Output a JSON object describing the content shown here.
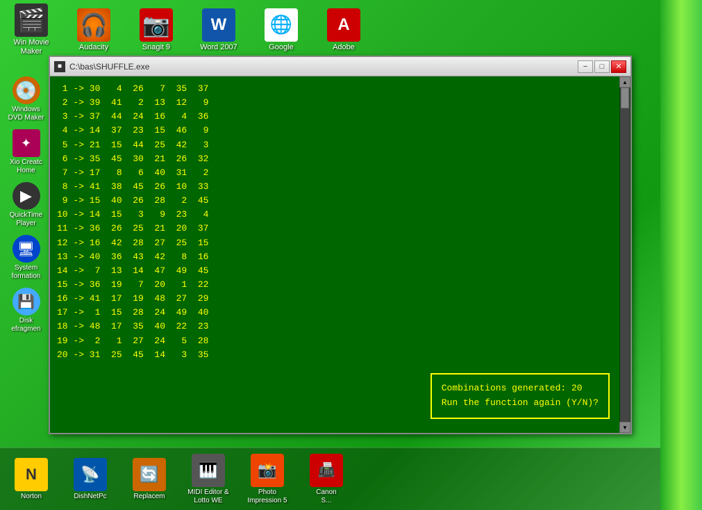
{
  "desktop": {
    "background": "#22aa22"
  },
  "top_icons": [
    {
      "id": "win-movie-maker",
      "label": "Win Movie\nMaker",
      "symbol": "🎬"
    },
    {
      "id": "audacity",
      "label": "Audacity",
      "symbol": "🎵"
    },
    {
      "id": "snagit-9",
      "label": "Snagit 9",
      "symbol": "📷"
    },
    {
      "id": "word-2007",
      "label": "Word 2007",
      "symbol": "W"
    },
    {
      "id": "google",
      "label": "Google",
      "symbol": "G"
    },
    {
      "id": "adobe",
      "label": "Adobe",
      "symbol": "A"
    }
  ],
  "left_icons": [
    {
      "id": "windows-dvd-maker",
      "label": "Windows\nDVD Maker",
      "symbol": "💿"
    },
    {
      "id": "xio-create-home",
      "label": "Xio Creat\nHome",
      "symbol": "✦"
    },
    {
      "id": "quicktime-player",
      "label": "QuickTime\nPlayer",
      "symbol": "▶"
    },
    {
      "id": "system-information",
      "label": "System\nformation",
      "symbol": "🖥"
    },
    {
      "id": "disk-defragment",
      "label": "Disk\nefragmen",
      "symbol": "💾"
    }
  ],
  "taskbar_icons": [
    {
      "id": "norton",
      "label": "Norton",
      "symbol": "N"
    },
    {
      "id": "dishnetpc",
      "label": "DishNetPc",
      "symbol": "📡"
    },
    {
      "id": "replacem",
      "label": "Replacem",
      "symbol": "🔄"
    },
    {
      "id": "midi-editor-lotto",
      "label": "MIDI Editor &\nLotto WE",
      "symbol": "🎹"
    },
    {
      "id": "photo-impression-5",
      "label": "Photo\nImpression 5",
      "symbol": "📸"
    },
    {
      "id": "canon",
      "label": "Canon\nS...",
      "symbol": "📠"
    }
  ],
  "window": {
    "title": "C:\\bas\\SHUFFLE.exe",
    "min_label": "−",
    "max_label": "□",
    "close_label": "✕"
  },
  "console": {
    "lines": [
      " 1 -> 30   4  26   7  35  37",
      " 2 -> 39  41   2  13  12   9",
      " 3 -> 37  44  24  16   4  36",
      " 4 -> 14  37  23  15  46   9",
      " 5 -> 21  15  44  25  42   3",
      " 6 -> 35  45  30  21  26  32",
      " 7 -> 17   8   6  40  31   2",
      " 8 -> 41  38  45  26  10  33",
      " 9 -> 15  40  26  28   2  45",
      "10 -> 14  15   3   9  23   4",
      "11 -> 36  26  25  21  20  37",
      "12 -> 16  42  28  27  25  15",
      "13 -> 40  36  43  42   8  16",
      "14 ->  7  13  14  47  49  45",
      "15 -> 36  19   7  20   1  22",
      "16 -> 41  17  19  48  27  29",
      "17 ->  1  15  28  24  49  40",
      "18 -> 48  17  35  40  22  23",
      "19 ->  2   1  27  24   5  28",
      "20 -> 31  25  45  14   3  35"
    ],
    "prompt_line1": "Combinations generated:  20",
    "prompt_line2": "Run the function again (Y/N)?"
  }
}
